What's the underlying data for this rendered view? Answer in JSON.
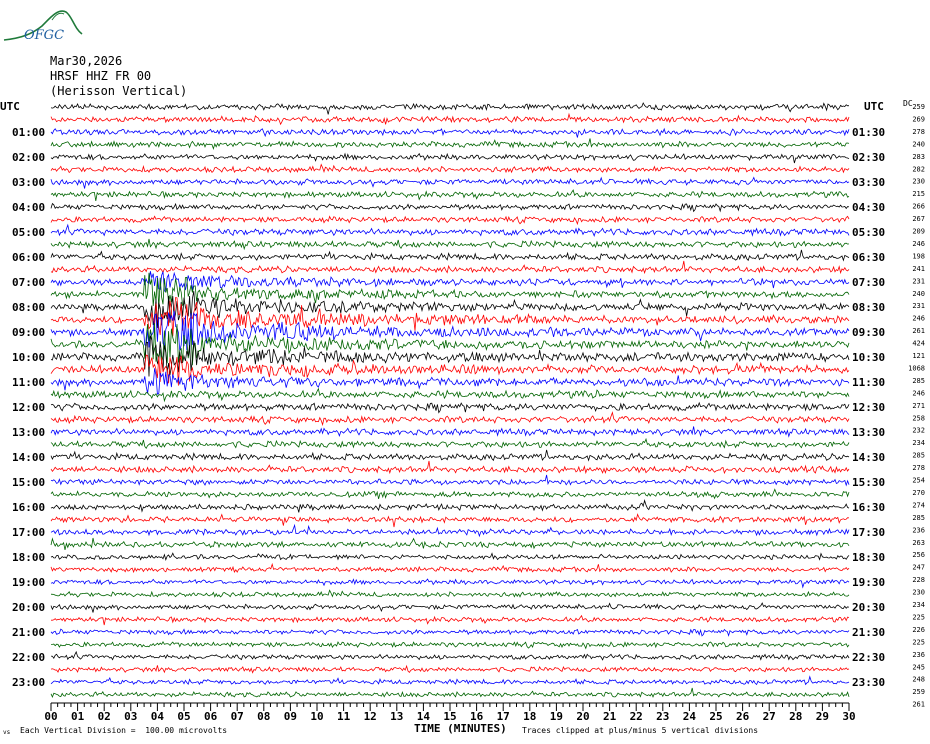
{
  "header": {
    "logo_text": "OFGC",
    "date": "Mar30,2026",
    "station": "HRSF HHZ FR 00",
    "location": "(Herisson Vertical)"
  },
  "left_axis_title": "UTC",
  "right_axis_title": "UTC",
  "right_column_header": "DC",
  "footer": {
    "left_mark": "vs",
    "scale_note": "Each Vertical Division =  100.00 microvolts",
    "x_title": "TIME (MINUTES)",
    "clip_note": "Traces clipped at plus/minus 5 vertical divisions"
  },
  "colors": {
    "trace_cycle": [
      "#000000",
      "#ff0000",
      "#0000ff",
      "#006400"
    ],
    "logo": "#1f7a3a"
  },
  "chart_data": {
    "type": "line",
    "title": "",
    "xlabel": "TIME (MINUTES)",
    "x_range": [
      0,
      30
    ],
    "x_ticks": [
      "00",
      "01",
      "02",
      "03",
      "04",
      "05",
      "06",
      "07",
      "08",
      "09",
      "10",
      "11",
      "12",
      "13",
      "14",
      "15",
      "16",
      "17",
      "18",
      "19",
      "20",
      "21",
      "22",
      "23",
      "24",
      "25",
      "26",
      "27",
      "28",
      "29",
      "30"
    ],
    "left_hour_labels": [
      "01:00",
      "02:00",
      "03:00",
      "04:00",
      "05:00",
      "06:00",
      "07:00",
      "08:00",
      "09:00",
      "10:00",
      "11:00",
      "12:00",
      "13:00",
      "14:00",
      "15:00",
      "16:00",
      "17:00",
      "18:00",
      "19:00",
      "20:00",
      "21:00",
      "22:00",
      "23:00"
    ],
    "right_hour_labels": [
      "01:30",
      "02:30",
      "03:30",
      "04:30",
      "05:30",
      "06:30",
      "07:30",
      "08:30",
      "09:30",
      "10:30",
      "11:30",
      "12:30",
      "13:30",
      "14:30",
      "15:30",
      "16:30",
      "17:30",
      "18:30",
      "19:30",
      "20:30",
      "21:30",
      "22:30",
      "23:30"
    ],
    "trace_count": 48,
    "dc_offsets": [
      259,
      269,
      278,
      240,
      283,
      282,
      230,
      215,
      266,
      267,
      209,
      246,
      198,
      241,
      231,
      240,
      231,
      246,
      261,
      424,
      121,
      1068,
      285,
      246,
      271,
      258,
      232,
      234,
      285,
      278,
      254,
      270,
      274,
      285,
      236,
      263,
      256,
      247,
      228,
      230,
      234,
      225,
      226,
      225,
      236,
      245,
      248,
      259,
      261
    ],
    "activity_levels": [
      0.7,
      0.7,
      0.7,
      0.7,
      0.7,
      0.7,
      0.7,
      0.7,
      0.7,
      0.7,
      0.8,
      0.8,
      0.8,
      0.8,
      0.8,
      0.8,
      0.8,
      0.9,
      0.9,
      0.9,
      1.0,
      1.0,
      0.9,
      0.9,
      0.9,
      0.8,
      0.8,
      0.8,
      0.8,
      0.8,
      0.7,
      0.7,
      0.7,
      0.7,
      0.7,
      0.7,
      0.6,
      0.6,
      0.6,
      0.6,
      0.6,
      0.6,
      0.6,
      0.6,
      0.6,
      0.6,
      0.6,
      0.6
    ],
    "event": {
      "hour_index_start": 14,
      "hour_index_end": 22,
      "minute_start": 3.5,
      "minute_end": 5.5
    }
  }
}
